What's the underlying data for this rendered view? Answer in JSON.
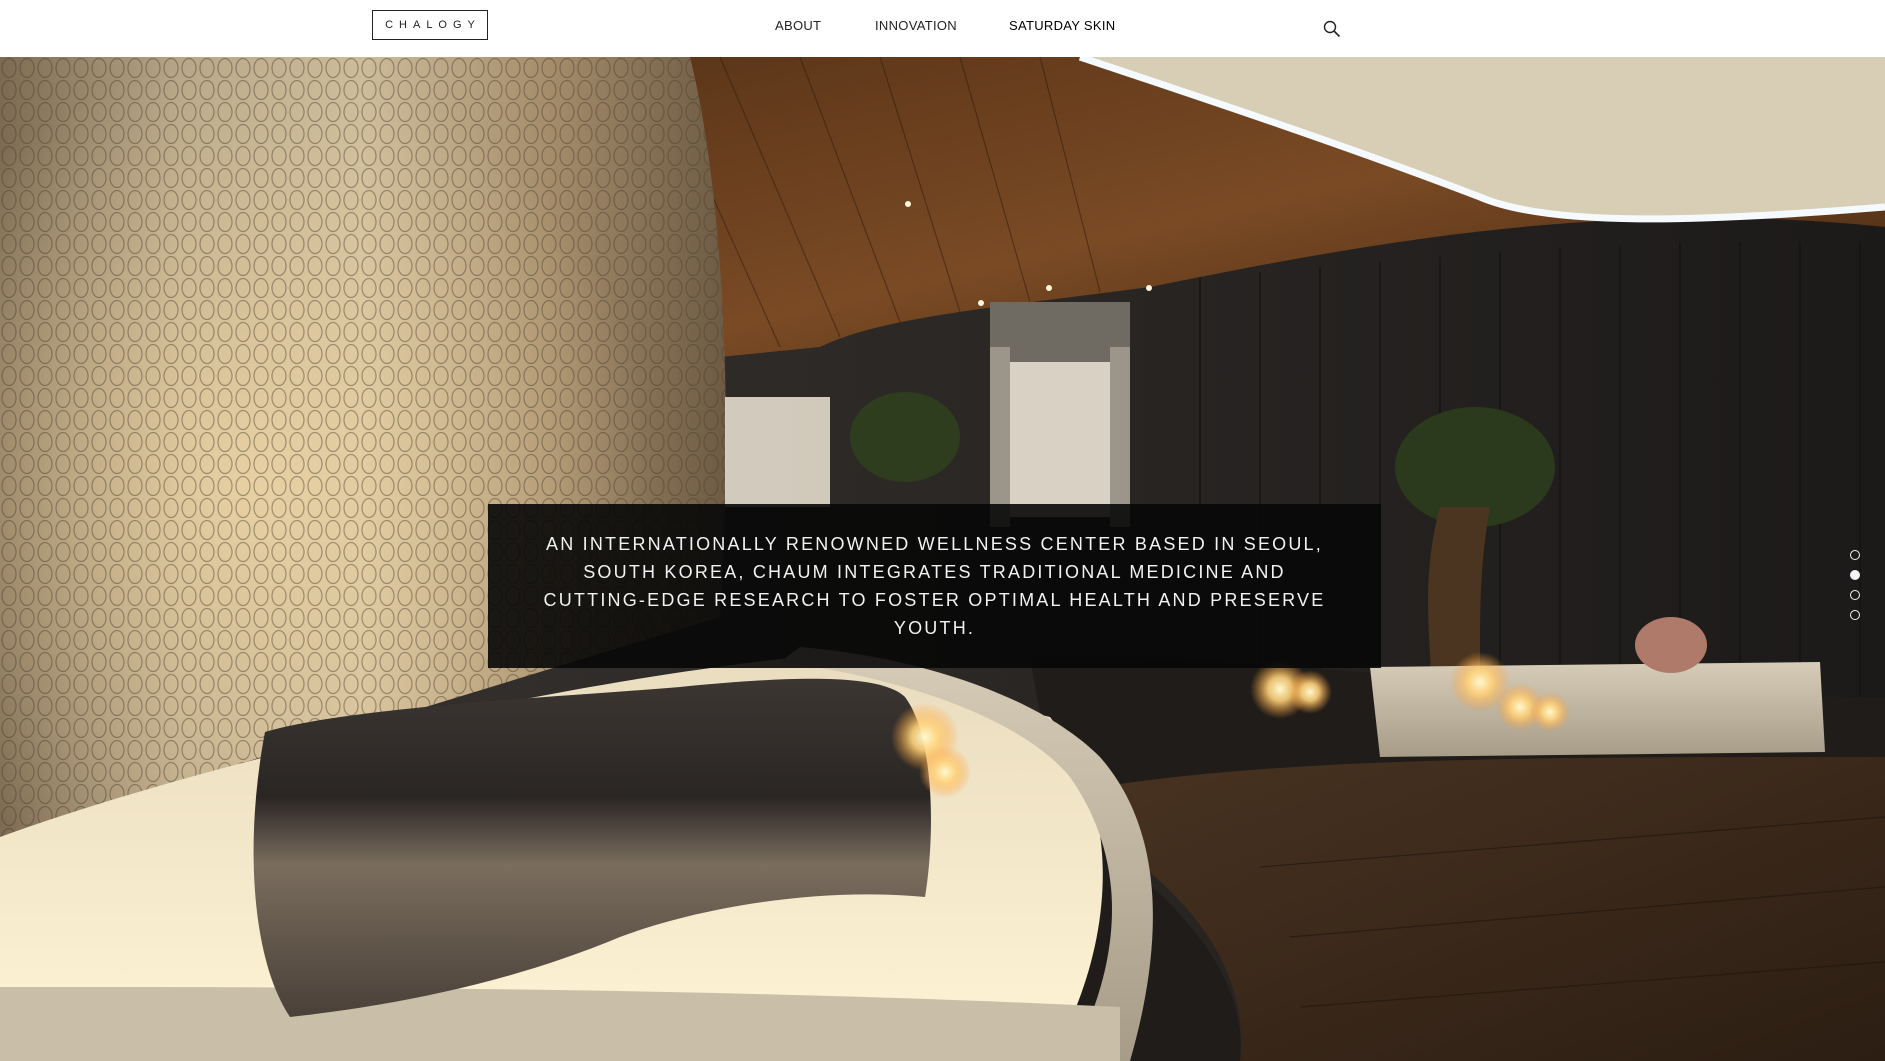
{
  "header": {
    "logo_text": "CHALOGY",
    "nav": [
      {
        "label": "ABOUT"
      },
      {
        "label": "INNOVATION"
      },
      {
        "label": "SATURDAY SKIN"
      }
    ],
    "search_icon": "search-icon"
  },
  "hero": {
    "caption": "AN INTERNATIONALLY RENOWNED WELLNESS CENTER BASED IN SEOUL, SOUTH KOREA, CHAUM INTEGRATES TRADITIONAL MEDICINE AND CUTTING-EDGE RESEARCH TO FOSTER OPTIMAL HEALTH AND PRESERVE YOUTH.",
    "slides_total": 4,
    "active_slide": 2
  },
  "colors": {
    "header_bg": "#ffffff",
    "caption_bg": "#080808",
    "caption_text": "#f2f2f2"
  }
}
